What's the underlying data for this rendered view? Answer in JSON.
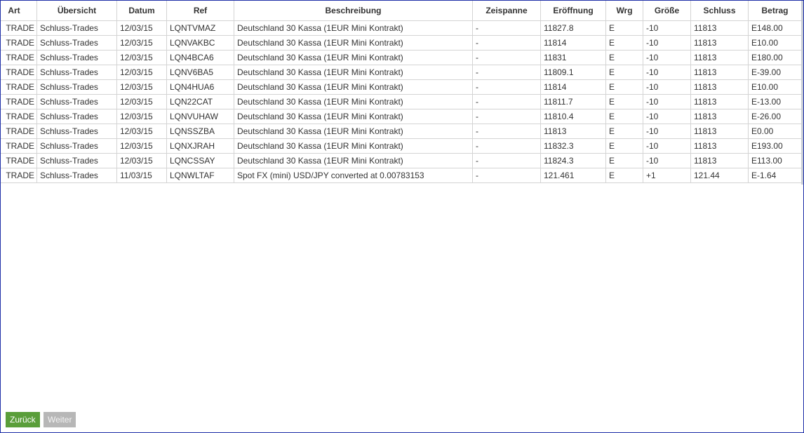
{
  "table": {
    "headers": [
      "Art",
      "Übersicht",
      "Datum",
      "Ref",
      "Beschreibung",
      "Zeispanne",
      "Eröffnung",
      "Wrg",
      "Größe",
      "Schluss",
      "Betrag"
    ],
    "rows": [
      [
        "TRADE",
        "Schluss-Trades",
        "12/03/15",
        "LQNTVMAZ",
        "Deutschland 30 Kassa (1EUR Mini Kontrakt)",
        "-",
        "11827.8",
        "E",
        "-10",
        "11813",
        "E148.00"
      ],
      [
        "TRADE",
        "Schluss-Trades",
        "12/03/15",
        "LQNVAKBC",
        "Deutschland 30 Kassa (1EUR Mini Kontrakt)",
        "-",
        "11814",
        "E",
        "-10",
        "11813",
        "E10.00"
      ],
      [
        "TRADE",
        "Schluss-Trades",
        "12/03/15",
        "LQN4BCA6",
        "Deutschland 30 Kassa (1EUR Mini Kontrakt)",
        "-",
        "11831",
        "E",
        "-10",
        "11813",
        "E180.00"
      ],
      [
        "TRADE",
        "Schluss-Trades",
        "12/03/15",
        "LQNV6BA5",
        "Deutschland 30 Kassa (1EUR Mini Kontrakt)",
        "-",
        "11809.1",
        "E",
        "-10",
        "11813",
        "E-39.00"
      ],
      [
        "TRADE",
        "Schluss-Trades",
        "12/03/15",
        "LQN4HUA6",
        "Deutschland 30 Kassa (1EUR Mini Kontrakt)",
        "-",
        "11814",
        "E",
        "-10",
        "11813",
        "E10.00"
      ],
      [
        "TRADE",
        "Schluss-Trades",
        "12/03/15",
        "LQN22CAT",
        "Deutschland 30 Kassa (1EUR Mini Kontrakt)",
        "-",
        "11811.7",
        "E",
        "-10",
        "11813",
        "E-13.00"
      ],
      [
        "TRADE",
        "Schluss-Trades",
        "12/03/15",
        "LQNVUHAW",
        "Deutschland 30 Kassa (1EUR Mini Kontrakt)",
        "-",
        "11810.4",
        "E",
        "-10",
        "11813",
        "E-26.00"
      ],
      [
        "TRADE",
        "Schluss-Trades",
        "12/03/15",
        "LQNSSZBA",
        "Deutschland 30 Kassa (1EUR Mini Kontrakt)",
        "-",
        "11813",
        "E",
        "-10",
        "11813",
        "E0.00"
      ],
      [
        "TRADE",
        "Schluss-Trades",
        "12/03/15",
        "LQNXJRAH",
        "Deutschland 30 Kassa (1EUR Mini Kontrakt)",
        "-",
        "11832.3",
        "E",
        "-10",
        "11813",
        "E193.00"
      ],
      [
        "TRADE",
        "Schluss-Trades",
        "12/03/15",
        "LQNCSSAY",
        "Deutschland 30 Kassa (1EUR Mini Kontrakt)",
        "-",
        "11824.3",
        "E",
        "-10",
        "11813",
        "E113.00"
      ],
      [
        "TRADE",
        "Schluss-Trades",
        "11/03/15",
        "LQNWLTAF",
        "Spot FX (mini) USD/JPY converted at 0.00783153",
        "-",
        "121.461",
        "E",
        "+1",
        "121.44",
        "E-1.64"
      ]
    ]
  },
  "pagination": {
    "back_label": "Zurück",
    "next_label": "Weiter"
  },
  "colors": {
    "frame_border": "#1e2fa8",
    "back_button": "#5a9e3a",
    "next_button": "#b7b7b7"
  }
}
